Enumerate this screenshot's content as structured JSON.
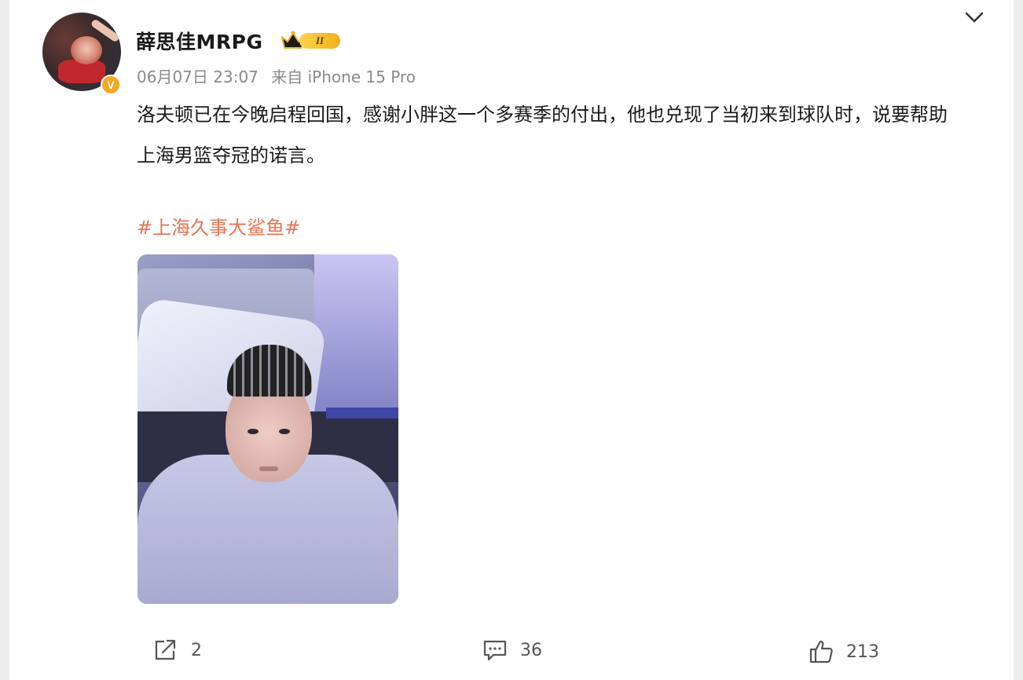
{
  "post": {
    "username": "薛思佳MRPG",
    "vip_level": "II",
    "verified_badge": "V",
    "timestamp": "06月07日 23:07",
    "source": "来自 iPhone 15 Pro",
    "content": "洛夫顿已在今晚启程回国，感谢小胖这一个多赛季的付出，他也兑现了当初来到球队时，说要帮助上海男篮夺冠的诺言。",
    "hashtag": "#上海久事大鲨鱼#"
  },
  "actions": {
    "repost_count": "2",
    "comment_count": "36",
    "like_count": "213"
  },
  "icons": {
    "repost": "share-icon",
    "comment": "comment-icon",
    "like": "thumbs-up-icon",
    "more": "chevron-down-icon",
    "vip": "crown-icon"
  },
  "colors": {
    "hashtag": "#eb7350",
    "meta_text": "#8a8a8a",
    "vip_gold": "#f2b11c",
    "verified_orange": "#f5a623"
  }
}
